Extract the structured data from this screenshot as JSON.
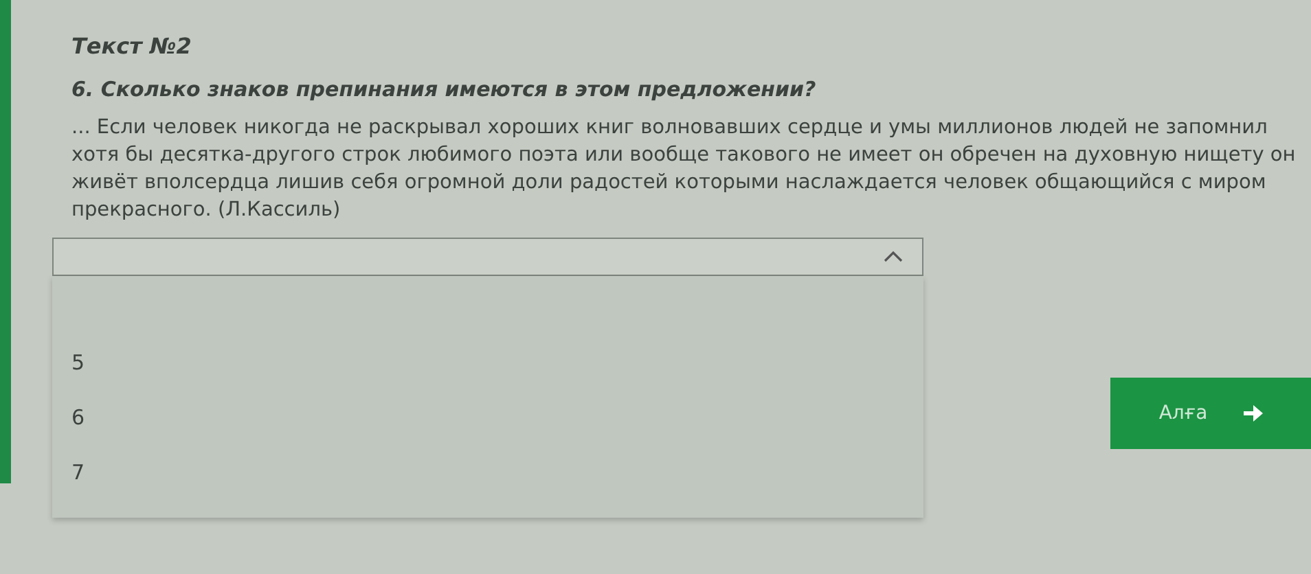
{
  "heading": "Текст №2",
  "question": "6. Сколько знаков препинания имеются в этом предложении?",
  "passage": "... Если человек никогда не раскрывал хороших книг волновавших сердце и умы миллионов людей не запомнил хотя бы десятка-другого строк любимого поэта или вообще такового не имеет он обречен на духовную нищету он живёт вполсердца лишив себя огромной доли радостей которыми наслаждается человек общающийся с миром прекрасного. (Л.Кассиль)",
  "dropdown": {
    "expanded": true,
    "options": [
      {
        "label": "5",
        "selected": false
      },
      {
        "label": "6",
        "selected": false
      },
      {
        "label": "7",
        "selected": false
      }
    ]
  },
  "next_button": {
    "label": "Алға"
  }
}
